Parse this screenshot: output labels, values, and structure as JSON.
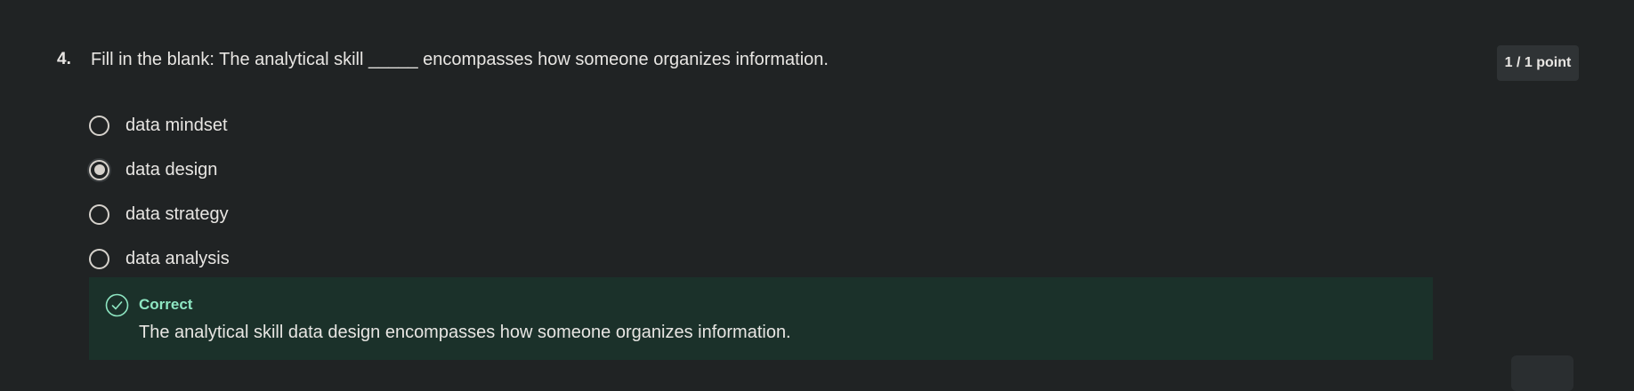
{
  "question": {
    "number": "4.",
    "text": "Fill in the blank: The analytical skill _____ encompasses how someone organizes information.",
    "points": "1 / 1 point"
  },
  "options": [
    {
      "label": "data mindset",
      "selected": false
    },
    {
      "label": "data design",
      "selected": true
    },
    {
      "label": "data strategy",
      "selected": false
    },
    {
      "label": "data analysis",
      "selected": false
    }
  ],
  "feedback": {
    "status": "Correct",
    "explanation": "The analytical skill data design encompasses how someone organizes information.",
    "status_color": "#8ee6c2",
    "background_color": "#1b312a",
    "icon": "check-circle-icon"
  },
  "corner_icon": "assistant-icon"
}
